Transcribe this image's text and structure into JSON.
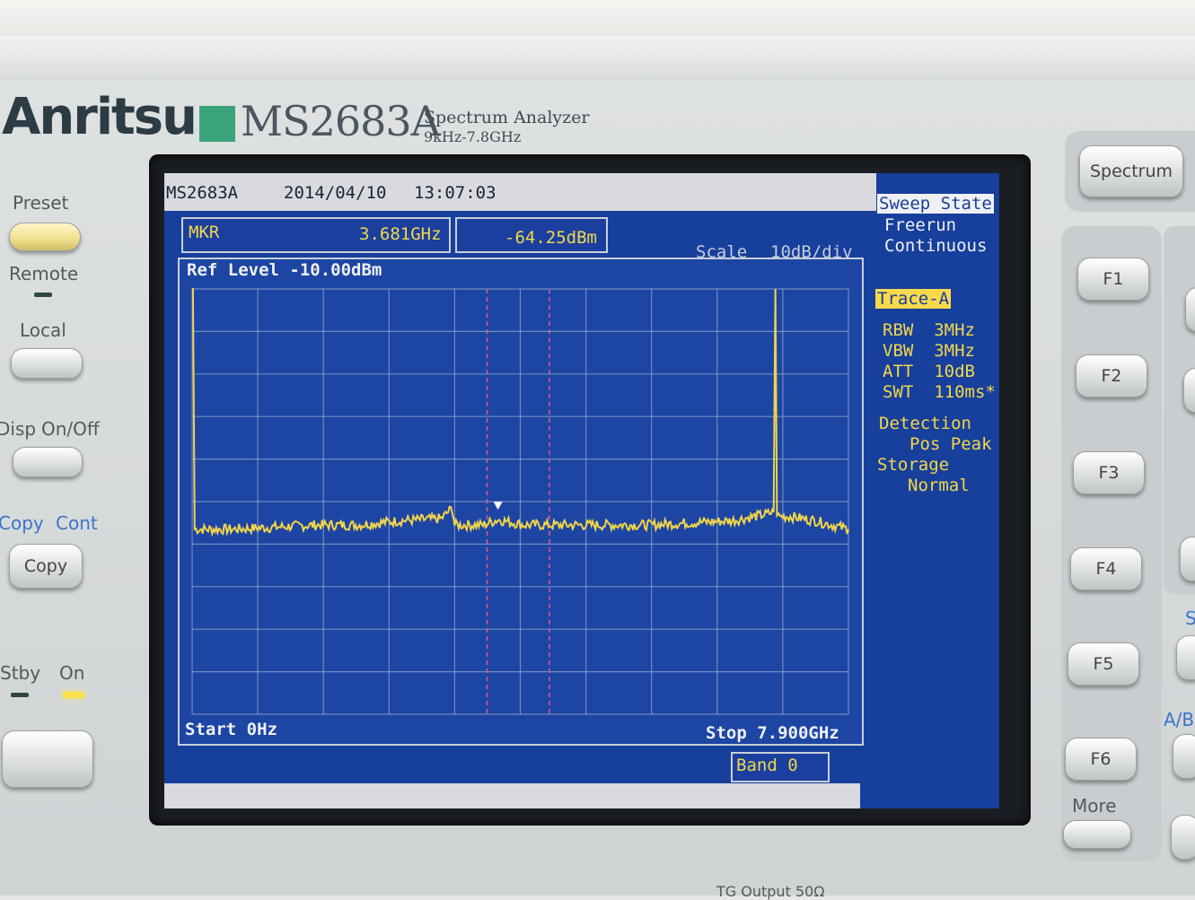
{
  "instrument": {
    "brand": "Anritsu",
    "model": "MS2683A",
    "subtitle_line1": "Spectrum Analyzer",
    "subtitle_line2": "9kHz-7.8GHz"
  },
  "left_panel": {
    "preset_label": "Preset",
    "remote_label": "Remote",
    "local_label": "Local",
    "disp_label": "Disp",
    "onoff_label": "On/Off",
    "copy_label": "Copy",
    "cont_label": "Cont",
    "copy_button": "Copy",
    "stby_label": "Stby",
    "on_label": "On"
  },
  "right_panel": {
    "spectrum_button": "Spectrum",
    "f_keys": [
      "F1",
      "F2",
      "F3",
      "F4",
      "F5",
      "F6"
    ],
    "more_label": "More",
    "ab_label": "A/B",
    "s_label": "S",
    "bottom_label": "TG Output 50Ω"
  },
  "screen": {
    "header": {
      "model": "MS2683A",
      "date": "2014/04/10",
      "time": "13:07:03"
    },
    "marker": {
      "label": "MKR",
      "freq": "3.681GHz",
      "level": "-64.25dBm"
    },
    "scale": {
      "label": "Scale",
      "value": "10dB/div"
    },
    "ref_level": "Ref Level -10.00dBm",
    "start": "Start 0Hz",
    "stop": "Stop 7.900GHz",
    "band": "Band 0",
    "side": {
      "sweep_state_title": "Sweep State",
      "sweep_mode1": "Freerun",
      "sweep_mode2": "Continuous",
      "trace_title": "Trace-A",
      "rbw": "RBW  3MHz",
      "vbw": "VBW  3MHz",
      "att": "ATT  10dB",
      "swt": "SWT  110ms*",
      "detection_title": "Detection",
      "detection_value": "Pos Peak",
      "storage_title": "Storage",
      "storage_value": "Normal"
    }
  },
  "colors": {
    "screen_bg": "#173f9c",
    "trace": "#f0d44a",
    "grid": "#8fa3c9",
    "highlight": "#f7d94c",
    "marker_window": "#e05a8a"
  },
  "chart_data": {
    "type": "line",
    "xlim": [
      0,
      7.9
    ],
    "ylim": [
      -110,
      -10
    ],
    "x_unit": "GHz",
    "y_unit": "dBm",
    "marker": {
      "x": 3.681,
      "y": -64.25
    },
    "marker_window": [
      3.55,
      4.3
    ],
    "series": [
      {
        "x": [
          0,
          0.01,
          0.03,
          0.5,
          1.0,
          1.5,
          2.0,
          2.5,
          3.0,
          3.13,
          3.16,
          3.5,
          3.681,
          4.0,
          4.5,
          5.0,
          5.5,
          6.0,
          6.5,
          6.9,
          7.0,
          7.02,
          7.04,
          7.06,
          7.2,
          7.5,
          7.9
        ],
        "y": [
          -10,
          -10,
          -66.5,
          -66.5,
          -66,
          -65.5,
          -65.5,
          -64.5,
          -64,
          -61.5,
          -65.5,
          -65.5,
          -64.25,
          -65.5,
          -65.5,
          -65.5,
          -65.5,
          -65,
          -64.5,
          -63,
          -62.5,
          -10,
          -62.5,
          -63.5,
          -63.5,
          -64.5,
          -66.5
        ]
      }
    ]
  }
}
